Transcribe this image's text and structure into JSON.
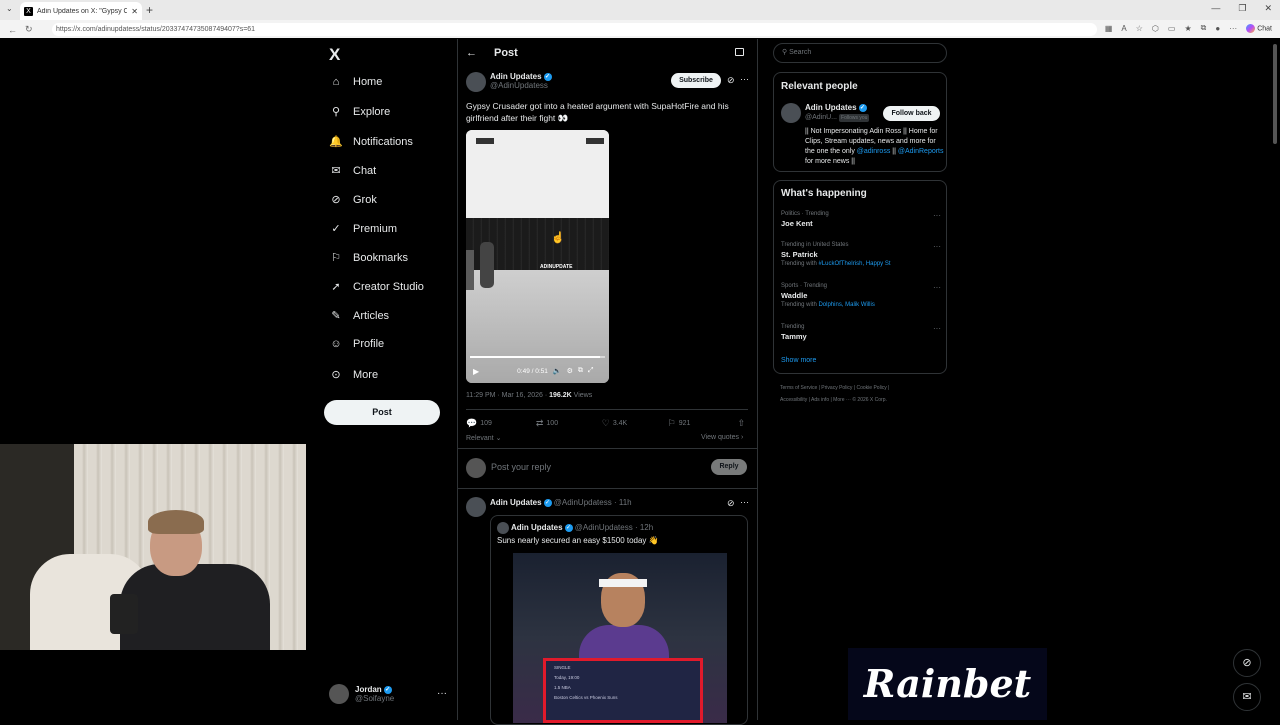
{
  "browser": {
    "tab_title": "Adin Updates on X: \"Gypsy Cr",
    "tab_close": "✕",
    "new_tab": "+",
    "url": "https://x.com/adinupdatess/status/2033747473508749407?s=61",
    "chat_label": "Chat"
  },
  "nav": {
    "logo": "X",
    "items": [
      {
        "label": "Home",
        "icon": "home-icon",
        "glyph": "⌂"
      },
      {
        "label": "Explore",
        "icon": "search-icon",
        "glyph": "⚲"
      },
      {
        "label": "Notifications",
        "icon": "bell-icon",
        "glyph": "🔔"
      },
      {
        "label": "Chat",
        "icon": "mail-icon",
        "glyph": "✉"
      },
      {
        "label": "Grok",
        "icon": "grok-icon",
        "glyph": "⊘"
      },
      {
        "label": "Premium",
        "icon": "premium-icon",
        "glyph": "✓"
      },
      {
        "label": "Bookmarks",
        "icon": "bookmark-icon",
        "glyph": "⚐"
      },
      {
        "label": "Creator Studio",
        "icon": "rocket-icon",
        "glyph": "➚"
      },
      {
        "label": "Articles",
        "icon": "article-icon",
        "glyph": "✎"
      },
      {
        "label": "Profile",
        "icon": "person-icon",
        "glyph": "☺"
      },
      {
        "label": "More",
        "icon": "more-circle-icon",
        "glyph": "⊙"
      }
    ],
    "post_button": "Post",
    "account": {
      "name": "Jordan",
      "handle": "@Soifayne",
      "more": "···"
    }
  },
  "main": {
    "back": "←",
    "title": "Post",
    "post": {
      "author": "Adin Updates",
      "handle": "@AdinUpdatess",
      "subscribe": "Subscribe",
      "text": "Gypsy Crusader got into a heated argument with SupaHotFire and his girlfriend after their fight 👀",
      "video": {
        "watermark": "ADINUPDATE",
        "time": "0:49 / 0:51",
        "progress": 0.96
      },
      "timestamp": "11:29 PM · Mar 16, 2026 · ",
      "views": "196.2K",
      "views_label": " Views",
      "replies": "109",
      "reposts": "100",
      "likes": "3.4K",
      "bookmarks": "921",
      "relevant": "Relevant ⌄",
      "view_quotes": "View quotes ›"
    },
    "reply": {
      "placeholder": "Post your reply",
      "button": "Reply"
    },
    "reply_tweet": {
      "author": "Adin Updates",
      "meta": "@AdinUpdatess · 11h",
      "quote": {
        "author": "Adin Updates",
        "meta": "@AdinUpdatess · 12h",
        "text": "Suns nearly secured an easy $1500 today 👋",
        "slip_lines": [
          "SINGLE",
          "Today, 19:00",
          "1.5  NBA",
          "Boston Celtics vs Phoenix Suns"
        ]
      }
    }
  },
  "right": {
    "search_placeholder": "Search",
    "relevant_title": "Relevant people",
    "person": {
      "name": "Adin Updates",
      "handle": "@AdinU...",
      "follows_you": "Follows you",
      "follow_button": "Follow back",
      "bio_1": "|| Not Impersonating Adin Ross || Home for Clips, Stream updates, news and more for the one the only ",
      "bio_link1": "@adinross",
      "bio_2": " || ",
      "bio_link2": "@AdinReports",
      "bio_3": " for more news ||"
    },
    "happening_title": "What's happening",
    "trends": [
      {
        "category": "Politics · Trending",
        "title": "Joe Kent",
        "sub_prefix": "",
        "sub_links": ""
      },
      {
        "category": "Trending in United States",
        "title": "St. Patrick",
        "sub_prefix": "Trending with ",
        "sub_links": "#LuckOfTheIrish, Happy St"
      },
      {
        "category": "Sports · Trending",
        "title": "Waddle",
        "sub_prefix": "Trending with ",
        "sub_links": "Dolphins, Malik Willis"
      },
      {
        "category": "Trending",
        "title": "Tammy",
        "sub_prefix": "",
        "sub_links": ""
      }
    ],
    "show_more": "Show more",
    "footer_1": "Terms of Service  |  Privacy Policy  |  Cookie Policy  |",
    "footer_2": "Accessibility  |  Ads info  |  More ···  © 2026 X Corp."
  },
  "overlay": {
    "sponsor": "Rainbet"
  }
}
